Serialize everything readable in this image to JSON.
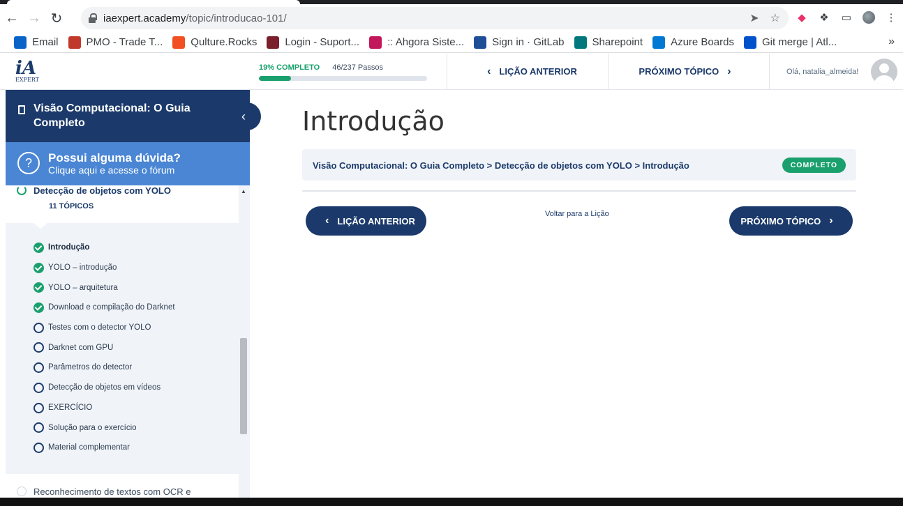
{
  "browser": {
    "url_host": "iaexpert.academy",
    "url_path": "/topic/introducao-101/"
  },
  "bookmarks": [
    {
      "label": "Email",
      "icon": "outlook-icon",
      "color": "#0a64c8"
    },
    {
      "label": "PMO - Trade T...",
      "icon": "pmo-icon",
      "color": "#c0392b"
    },
    {
      "label": "Qulture.Rocks",
      "icon": "microsoft-icon",
      "color": "#f25022"
    },
    {
      "label": "Login - Suport...",
      "icon": "star-icon",
      "color": "#7a1f2b"
    },
    {
      "label": ":: Ahgora Siste...",
      "icon": "ahgora-icon",
      "color": "#c2185b"
    },
    {
      "label": "Sign in · GitLab",
      "icon": "gitlab-icon",
      "color": "#1f4e99"
    },
    {
      "label": "Sharepoint",
      "icon": "sharepoint-icon",
      "color": "#03787c"
    },
    {
      "label": "Azure Boards",
      "icon": "azure-boards-icon",
      "color": "#0078d4"
    },
    {
      "label": "Git merge | Atl...",
      "icon": "atlassian-icon",
      "color": "#0052cc"
    }
  ],
  "header": {
    "progress_label": "19% COMPLETO",
    "progress_fraction": 0.19,
    "steps_label": "46/237 Passos",
    "prev_label": "LIÇÃO ANTERIOR",
    "next_label": "PRÓXIMO TÓPICO",
    "greeting": "Olá, natalia_almeida!"
  },
  "sidebar": {
    "course_title": "Visão Computacional: O Guia Completo",
    "help_title": "Possui alguma dúvida?",
    "help_subtitle": "Clique aqui e acesse o fórum",
    "section_name": "Detecção de objetos com YOLO",
    "section_count": "11 TÓPICOS",
    "topics": [
      {
        "label": "Introdução",
        "done": true,
        "current": true
      },
      {
        "label": "YOLO – introdução",
        "done": true
      },
      {
        "label": "YOLO – arquitetura",
        "done": true
      },
      {
        "label": "Download e compilação do Darknet",
        "done": true
      },
      {
        "label": "Testes com o detector YOLO",
        "done": false
      },
      {
        "label": "Darknet com GPU",
        "done": false
      },
      {
        "label": "Parâmetros do detector",
        "done": false
      },
      {
        "label": "Detecção de objetos em vídeos",
        "done": false
      },
      {
        "label": "EXERCÍCIO",
        "done": false
      },
      {
        "label": "Solução para o exercício",
        "done": false
      },
      {
        "label": "Material complementar",
        "done": false
      }
    ],
    "next_section": "Reconhecimento de textos com OCR e"
  },
  "main": {
    "title": "Introdução",
    "breadcrumb": "Visão Computacional: O Guia Completo > Detecção de objetos com YOLO > Introdução",
    "badge": "COMPLETO",
    "prev_button": "LIÇÃO ANTERIOR",
    "back_link": "Voltar para a Lição",
    "next_button": "PRÓXIMO TÓPICO"
  },
  "colors": {
    "brand_navy": "#1b3a6b",
    "accent_green": "#1aa06d",
    "help_blue": "#4a86d4"
  }
}
